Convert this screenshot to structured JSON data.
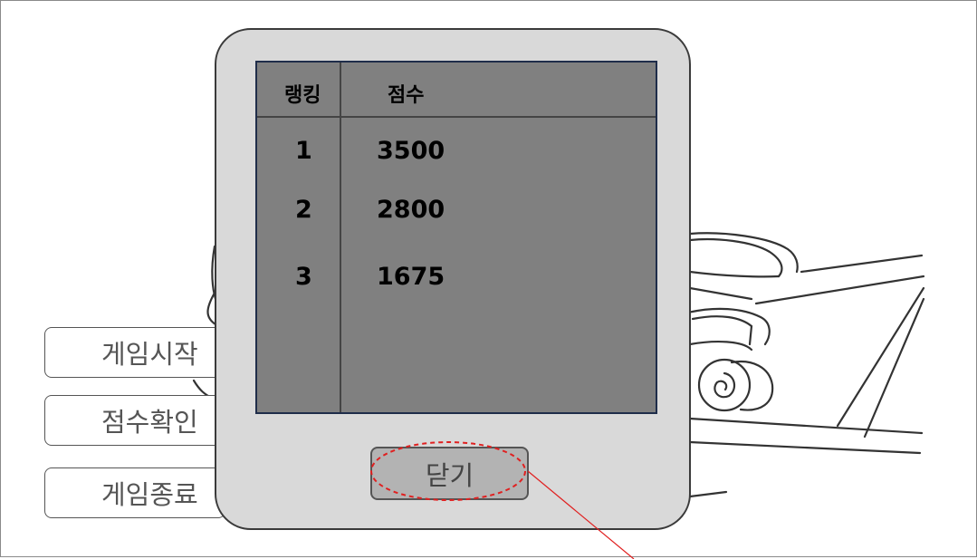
{
  "menu": {
    "start_label": "게임시작",
    "score_label": "점수확인",
    "exit_label": "게임종료"
  },
  "ranking_popup": {
    "header_rank": "랭킹",
    "header_score": "점수",
    "rows": [
      {
        "rank": "1",
        "score": "3500"
      },
      {
        "rank": "2",
        "score": "2800"
      },
      {
        "rank": "3",
        "score": "1675"
      }
    ],
    "close_label": "닫기"
  },
  "colors": {
    "popup_bg": "#d9d9d9",
    "table_bg": "#808080",
    "table_border": "#1f2d4a",
    "close_button_bg": "#b3b3b3",
    "annotation": "#e02020"
  }
}
